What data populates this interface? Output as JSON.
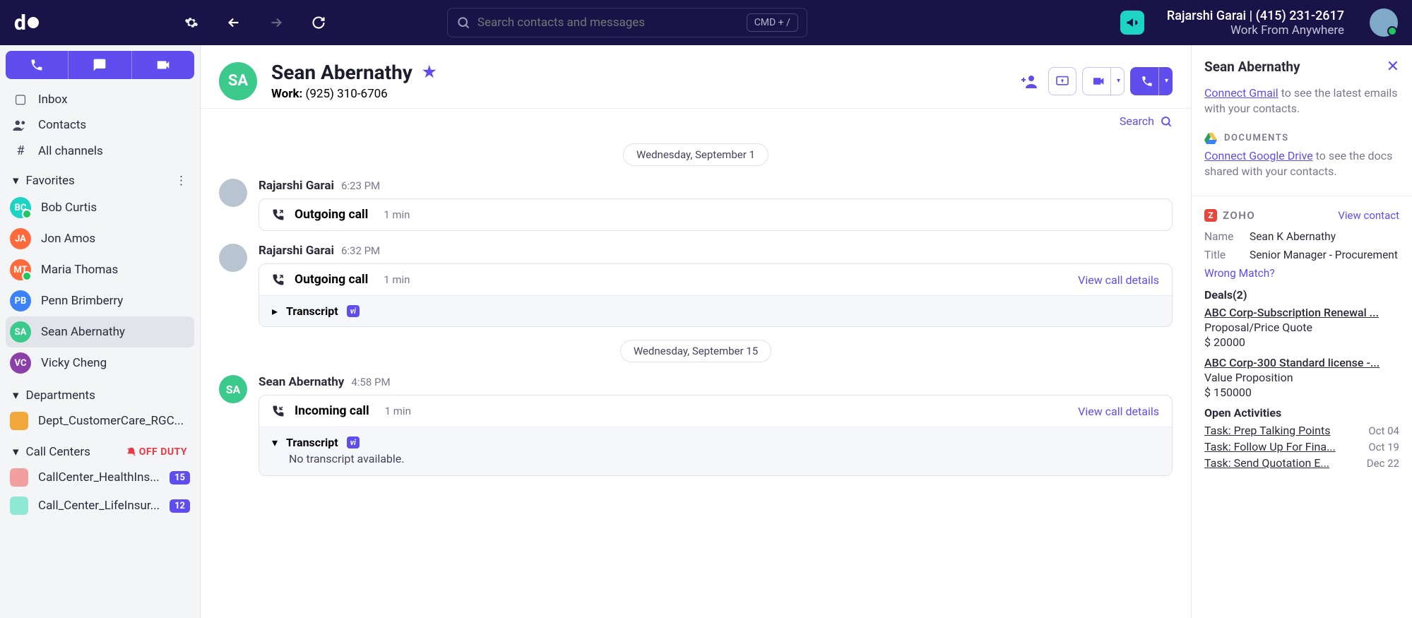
{
  "topbar": {
    "search_placeholder": "Search contacts and messages",
    "kbd_hint": "CMD + /",
    "user_line1": "Rajarshi Garai | (415) 231-2617",
    "user_line2": "Work From Anywhere"
  },
  "sidebar": {
    "nav": {
      "inbox": "Inbox",
      "contacts": "Contacts",
      "channels": "All channels"
    },
    "favorites_label": "Favorites",
    "favorites": [
      {
        "initials": "BC",
        "name": "Bob Curtis",
        "color": "#1dd3c4",
        "presence": true
      },
      {
        "initials": "JA",
        "name": "Jon Amos",
        "color": "#ff6a3d",
        "presence": false
      },
      {
        "initials": "MT",
        "name": "Maria Thomas",
        "color": "#ff6a3d",
        "presence": true
      },
      {
        "initials": "PB",
        "name": "Penn Brimberry",
        "color": "#3b82f6",
        "presence": false
      },
      {
        "initials": "SA",
        "name": "Sean Abernathy",
        "color": "#3bc98c",
        "presence": false
      },
      {
        "initials": "VC",
        "name": "Vicky Cheng",
        "color": "#8b3fa8",
        "presence": false
      }
    ],
    "departments_label": "Departments",
    "departments": [
      {
        "name": "Dept_CustomerCare_RGC...",
        "color": "#f2a83b"
      }
    ],
    "callcenters_label": "Call Centers",
    "off_duty": "OFF DUTY",
    "callcenters": [
      {
        "name": "CallCenter_HealthIns...",
        "color": "#f29fa0",
        "badge": "15"
      },
      {
        "name": "Call_Center_LifeInsur...",
        "color": "#8fe8d6",
        "badge": "12"
      }
    ]
  },
  "contact": {
    "initials": "SA",
    "name": "Sean Abernathy",
    "phone_label": "Work:",
    "phone": "(925) 310-6706",
    "search_label": "Search"
  },
  "feed": {
    "date1": "Wednesday, September 1",
    "msg1": {
      "name": "Rajarshi Garai",
      "time": "6:23 PM",
      "title": "Outgoing call",
      "duration": "1 min"
    },
    "msg2": {
      "name": "Rajarshi Garai",
      "time": "6:32 PM",
      "title": "Outgoing call",
      "duration": "1 min",
      "details": "View call details",
      "transcript_label": "Transcript"
    },
    "date2": "Wednesday, September 15",
    "msg3": {
      "name": "Sean Abernathy",
      "time": "4:58 PM",
      "title": "Incoming call",
      "duration": "1 min",
      "details": "View call details",
      "transcript_label": "Transcript",
      "transcript_body": "No transcript available."
    }
  },
  "rpanel": {
    "title": "Sean Abernathy",
    "gmail_link": "Connect Gmail",
    "gmail_text": " to see the latest emails with your contacts.",
    "docs_label": "DOCUMENTS",
    "gdrive_link": "Connect Google Drive",
    "gdrive_text": " to see the docs shared with your contacts.",
    "zoho_label": "ZOHO",
    "zoho_view": "View contact",
    "name_k": "Name",
    "name_v": "Sean K Abernathy",
    "title_k": "Title",
    "title_v": "Senior Manager - Procurement",
    "wrong": "Wrong Match?",
    "deals_h": "Deals(2)",
    "deals": [
      {
        "t": "ABC Corp-Subscription Renewal ...",
        "s": "Proposal/Price Quote",
        "v": "$ 20000"
      },
      {
        "t": "ABC Corp-300 Standard license -...",
        "s": "Value Proposition",
        "v": "$ 150000"
      }
    ],
    "acts_h": "Open Activities",
    "acts": [
      {
        "t": "Task: Prep Talking Points",
        "d": "Oct 04"
      },
      {
        "t": "Task: Follow Up For Fina...",
        "d": "Oct 19"
      },
      {
        "t": "Task: Send Quotation E...",
        "d": "Dec 22"
      }
    ]
  }
}
